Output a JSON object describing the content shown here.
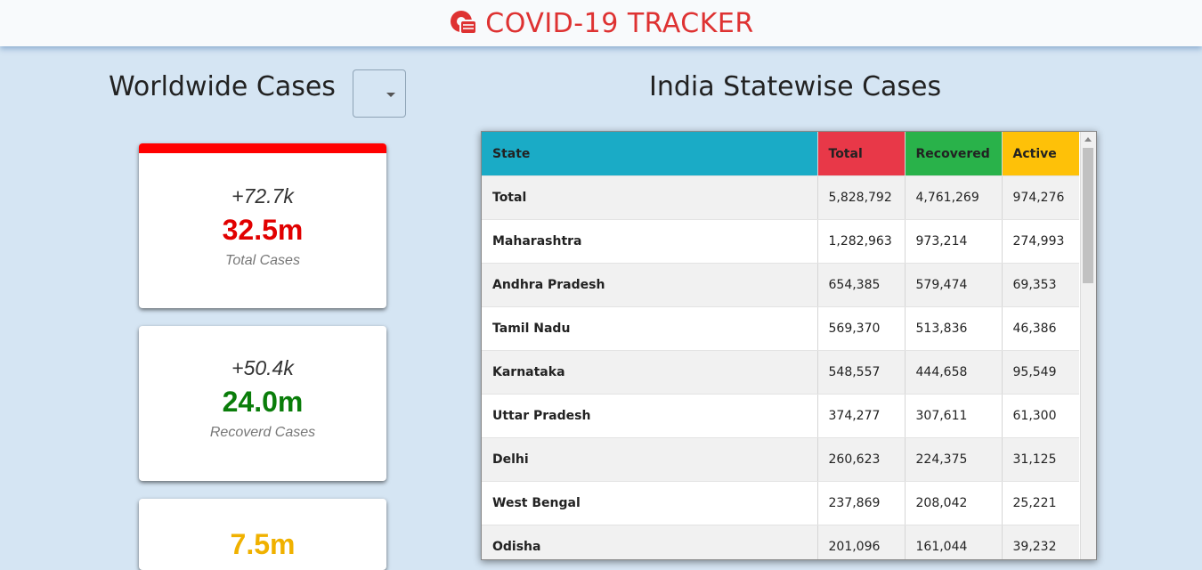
{
  "header": {
    "title": "COVID-19 TRACKER",
    "logo_icon": "virus-mask-icon",
    "title_color": "#de3232"
  },
  "worldwide": {
    "title": "Worldwide Cases",
    "dropdown_value": "",
    "cards": {
      "total": {
        "delta": "+72.7k",
        "value": "32.5m",
        "label": "Total Cases",
        "color": "#e10000"
      },
      "recovered": {
        "delta": "+50.4k",
        "value": "24.0m",
        "label": "Recoverd Cases",
        "color": "#0a7d0a"
      },
      "active": {
        "value": "7.5m",
        "color": "#f0b100"
      }
    }
  },
  "india": {
    "title": "India Statewise Cases",
    "columns": [
      "State",
      "Total",
      "Recovered",
      "Active"
    ],
    "rows": [
      [
        "Total",
        "5,828,792",
        "4,761,269",
        "974,276"
      ],
      [
        "Maharashtra",
        "1,282,963",
        "973,214",
        "274,993"
      ],
      [
        "Andhra Pradesh",
        "654,385",
        "579,474",
        "69,353"
      ],
      [
        "Tamil Nadu",
        "569,370",
        "513,836",
        "46,386"
      ],
      [
        "Karnataka",
        "548,557",
        "444,658",
        "95,549"
      ],
      [
        "Uttar Pradesh",
        "374,277",
        "307,611",
        "61,300"
      ],
      [
        "Delhi",
        "260,623",
        "224,375",
        "31,125"
      ],
      [
        "West Bengal",
        "237,869",
        "208,042",
        "25,221"
      ],
      [
        "Odisha",
        "201,096",
        "161,044",
        "39,232"
      ]
    ],
    "header_colors": {
      "state": "#1aabc6",
      "total": "#e83848",
      "recovered": "#29b24a",
      "active": "#fec108"
    }
  }
}
